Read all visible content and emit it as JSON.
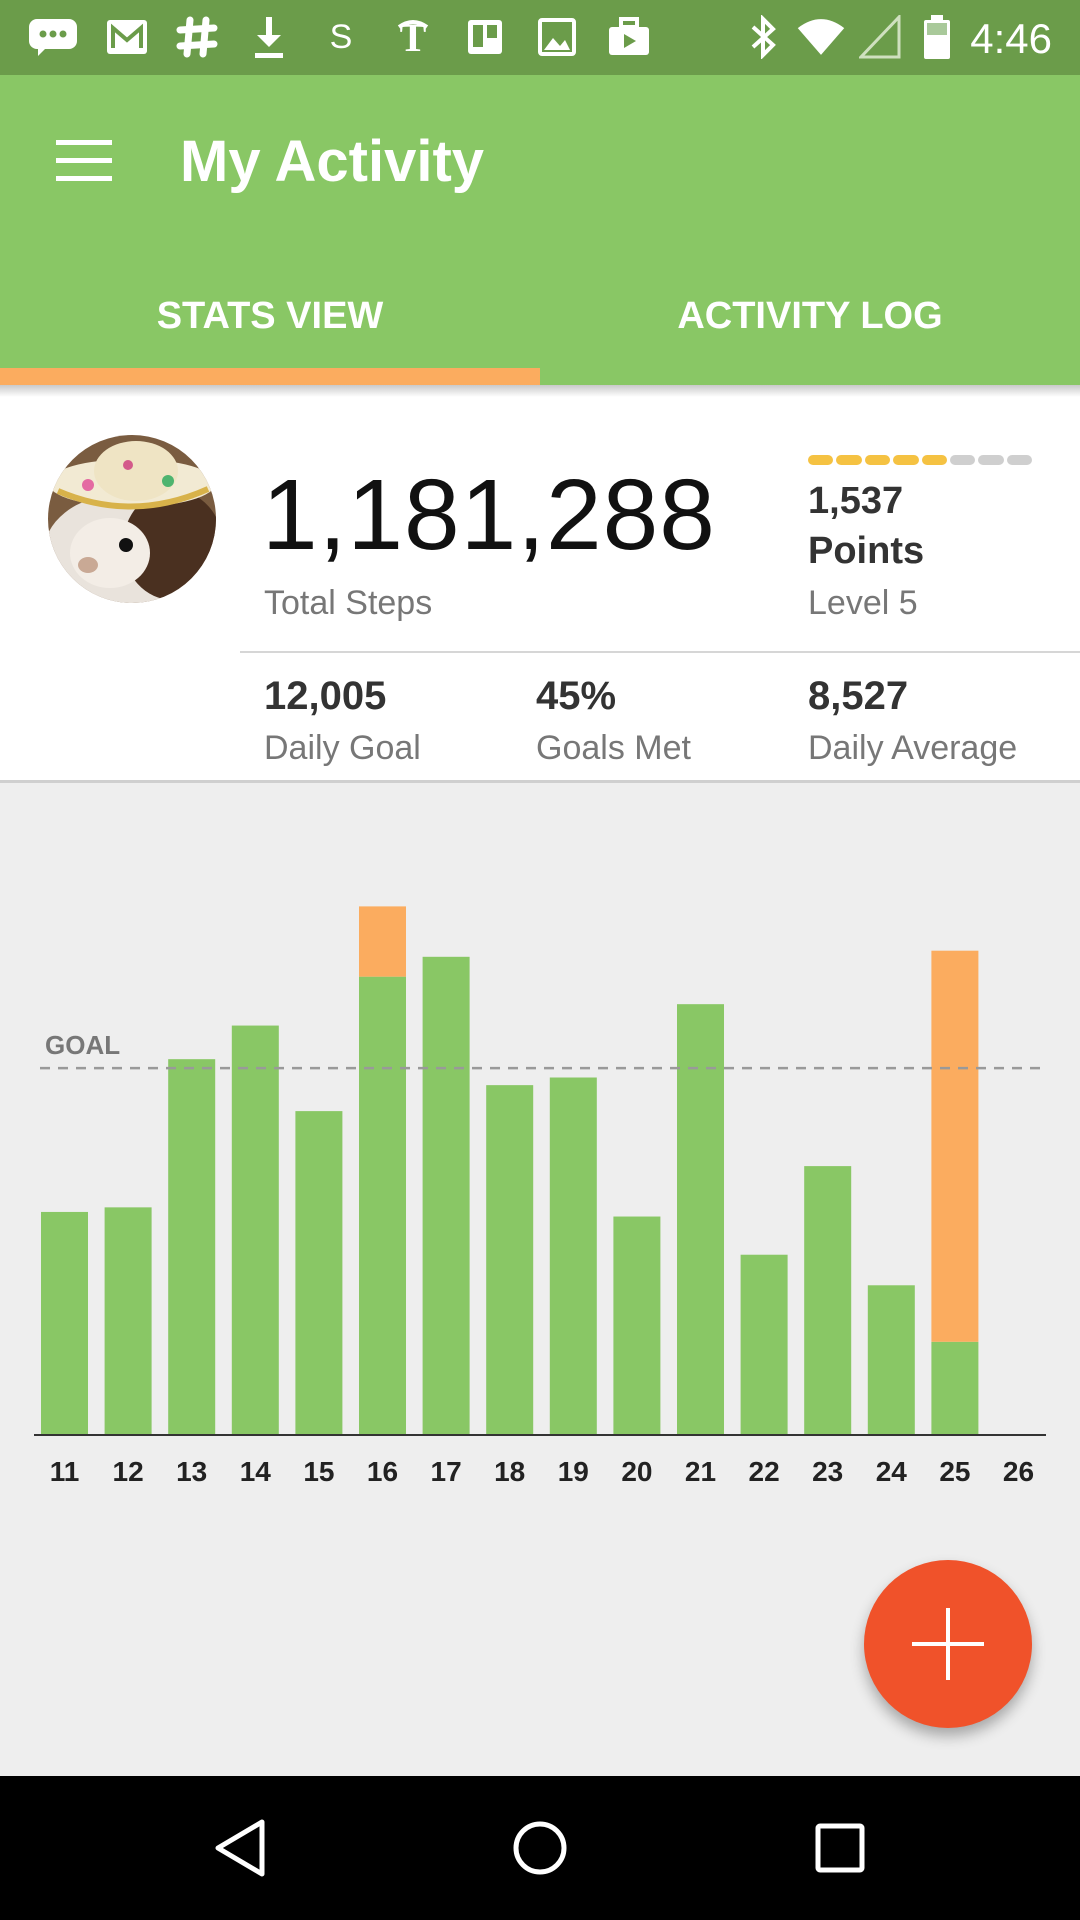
{
  "status_bar": {
    "time": "4:46",
    "icons": [
      "chat-icon",
      "gmail-icon",
      "slack-icon",
      "download-icon",
      "s-icon",
      "nytimes-icon",
      "trello-icon",
      "image-icon",
      "briefcase-icon",
      "bluetooth-icon",
      "wifi-icon",
      "signal-icon",
      "battery-icon"
    ]
  },
  "header": {
    "title": "My Activity",
    "menu_icon": "hamburger-menu-icon"
  },
  "tabs": [
    {
      "label": "STATS VIEW",
      "active": true
    },
    {
      "label": "ACTIVITY LOG",
      "active": false
    }
  ],
  "stats": {
    "total_steps": "1,181,288",
    "total_steps_label": "Total Steps",
    "points": "1,537",
    "points_label": "Points",
    "level": "Level 5",
    "level_progress_segments": 8,
    "level_progress_filled": 5,
    "daily_goal": "12,005",
    "daily_goal_label": "Daily Goal",
    "goals_met": "45%",
    "goals_met_label": "Goals Met",
    "daily_average": "8,527",
    "daily_average_label": "Daily Average"
  },
  "chart_data": {
    "type": "bar",
    "goal_label": "GOAL",
    "goal": 12005,
    "ylim": [
      0,
      18000
    ],
    "categories": [
      "11",
      "12",
      "13",
      "14",
      "15",
      "16",
      "17",
      "18",
      "19",
      "20",
      "21",
      "22",
      "23",
      "24",
      "25",
      "26"
    ],
    "series": [
      {
        "values": [
          7300,
          7450,
          12300,
          13400,
          10600,
          15000,
          15650,
          11450,
          11700,
          7150,
          14100,
          5900,
          8800,
          4900,
          3050,
          0
        ]
      },
      {
        "values": [
          0,
          0,
          0,
          0,
          0,
          2300,
          0,
          0,
          0,
          0,
          0,
          0,
          0,
          0,
          12800,
          0
        ]
      }
    ],
    "colors": {
      "base": "#89c765",
      "extra": "#fbac5f",
      "goal_line": "#999999"
    }
  },
  "fab": {
    "icon": "plus-icon"
  },
  "nav": [
    "back-icon",
    "home-icon",
    "recents-icon"
  ],
  "colors": {
    "primary": "#89c765",
    "status_bar": "#6b9c4a",
    "accent": "#fbac5f",
    "fab": "#f0522a",
    "level_bar_filled": "#f5c242",
    "level_bar_empty": "#cfcfcf"
  }
}
